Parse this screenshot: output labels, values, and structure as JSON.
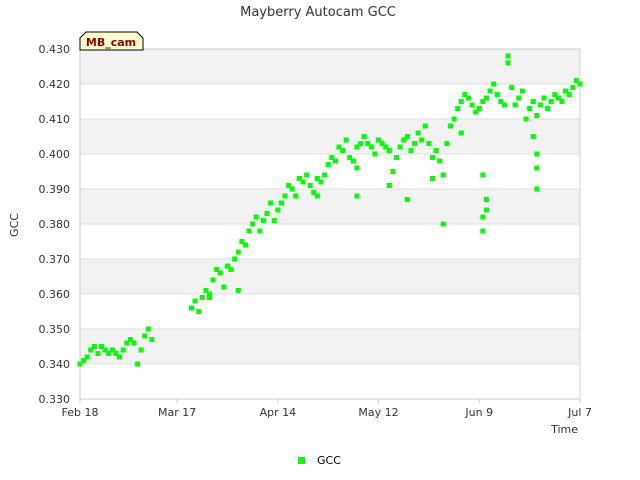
{
  "chart_data": {
    "type": "scatter",
    "title": "Mayberry Autocam GCC",
    "xlabel": "Time",
    "ylabel": "GCC",
    "badge": "MB_cam",
    "ylim": [
      0.33,
      0.43
    ],
    "yticks": [
      "0.330",
      "0.340",
      "0.350",
      "0.360",
      "0.370",
      "0.380",
      "0.390",
      "0.400",
      "0.410",
      "0.420",
      "0.430"
    ],
    "xlim": [
      "2014-02-18",
      "2014-07-07"
    ],
    "xticks": [
      {
        "date": "2014-02-18",
        "label": "Feb 18"
      },
      {
        "date": "2014-03-17",
        "label": "Mar 17"
      },
      {
        "date": "2014-04-14",
        "label": "Apr 14"
      },
      {
        "date": "2014-05-12",
        "label": "May 12"
      },
      {
        "date": "2014-06-09",
        "label": "Jun 9"
      },
      {
        "date": "2014-07-07",
        "label": "Jul 7"
      }
    ],
    "grid": true,
    "legend_position": "bottom-center",
    "series": [
      {
        "name": "GCC",
        "color": "#00ff00",
        "points": [
          [
            "2014-02-18",
            0.34
          ],
          [
            "2014-02-19",
            0.341
          ],
          [
            "2014-02-20",
            0.342
          ],
          [
            "2014-02-21",
            0.344
          ],
          [
            "2014-02-22",
            0.345
          ],
          [
            "2014-02-23",
            0.343
          ],
          [
            "2014-02-24",
            0.345
          ],
          [
            "2014-02-25",
            0.344
          ],
          [
            "2014-02-26",
            0.343
          ],
          [
            "2014-02-27",
            0.344
          ],
          [
            "2014-02-28",
            0.343
          ],
          [
            "2014-03-01",
            0.342
          ],
          [
            "2014-03-02",
            0.344
          ],
          [
            "2014-03-03",
            0.346
          ],
          [
            "2014-03-04",
            0.347
          ],
          [
            "2014-03-05",
            0.346
          ],
          [
            "2014-03-06",
            0.34
          ],
          [
            "2014-03-07",
            0.344
          ],
          [
            "2014-03-08",
            0.348
          ],
          [
            "2014-03-09",
            0.35
          ],
          [
            "2014-03-10",
            0.347
          ],
          [
            "2014-03-21",
            0.356
          ],
          [
            "2014-03-22",
            0.358
          ],
          [
            "2014-03-23",
            0.355
          ],
          [
            "2014-03-24",
            0.359
          ],
          [
            "2014-03-25",
            0.361
          ],
          [
            "2014-03-26",
            0.36
          ],
          [
            "2014-03-27",
            0.364
          ],
          [
            "2014-03-28",
            0.367
          ],
          [
            "2014-03-29",
            0.366
          ],
          [
            "2014-03-30",
            0.362
          ],
          [
            "2014-03-31",
            0.368
          ],
          [
            "2014-04-01",
            0.367
          ],
          [
            "2014-04-02",
            0.37
          ],
          [
            "2014-04-03",
            0.372
          ],
          [
            "2014-04-04",
            0.375
          ],
          [
            "2014-04-05",
            0.374
          ],
          [
            "2014-04-06",
            0.378
          ],
          [
            "2014-04-07",
            0.38
          ],
          [
            "2014-04-08",
            0.382
          ],
          [
            "2014-04-09",
            0.378
          ],
          [
            "2014-04-10",
            0.381
          ],
          [
            "2014-04-11",
            0.383
          ],
          [
            "2014-04-12",
            0.386
          ],
          [
            "2014-04-13",
            0.381
          ],
          [
            "2014-04-14",
            0.384
          ],
          [
            "2014-04-15",
            0.386
          ],
          [
            "2014-04-16",
            0.388
          ],
          [
            "2014-04-17",
            0.391
          ],
          [
            "2014-04-18",
            0.39
          ],
          [
            "2014-04-19",
            0.388
          ],
          [
            "2014-04-20",
            0.393
          ],
          [
            "2014-04-21",
            0.392
          ],
          [
            "2014-04-22",
            0.394
          ],
          [
            "2014-04-23",
            0.391
          ],
          [
            "2014-04-24",
            0.389
          ],
          [
            "2014-04-25",
            0.393
          ],
          [
            "2014-04-26",
            0.392
          ],
          [
            "2014-04-27",
            0.394
          ],
          [
            "2014-04-28",
            0.397
          ],
          [
            "2014-04-29",
            0.399
          ],
          [
            "2014-04-30",
            0.398
          ],
          [
            "2014-05-01",
            0.402
          ],
          [
            "2014-05-02",
            0.401
          ],
          [
            "2014-05-03",
            0.404
          ],
          [
            "2014-05-04",
            0.399
          ],
          [
            "2014-05-05",
            0.398
          ],
          [
            "2014-05-06",
            0.402
          ],
          [
            "2014-05-07",
            0.403
          ],
          [
            "2014-05-08",
            0.405
          ],
          [
            "2014-05-09",
            0.403
          ],
          [
            "2014-05-10",
            0.402
          ],
          [
            "2014-05-11",
            0.4
          ],
          [
            "2014-05-12",
            0.404
          ],
          [
            "2014-05-13",
            0.403
          ],
          [
            "2014-05-14",
            0.402
          ],
          [
            "2014-05-15",
            0.401
          ],
          [
            "2014-05-16",
            0.395
          ],
          [
            "2014-05-17",
            0.399
          ],
          [
            "2014-05-18",
            0.402
          ],
          [
            "2014-05-19",
            0.404
          ],
          [
            "2014-05-20",
            0.405
          ],
          [
            "2014-05-21",
            0.401
          ],
          [
            "2014-05-22",
            0.403
          ],
          [
            "2014-05-23",
            0.406
          ],
          [
            "2014-05-24",
            0.404
          ],
          [
            "2014-05-25",
            0.408
          ],
          [
            "2014-05-26",
            0.403
          ],
          [
            "2014-05-27",
            0.399
          ],
          [
            "2014-05-28",
            0.401
          ],
          [
            "2014-05-29",
            0.398
          ],
          [
            "2014-05-30",
            0.394
          ],
          [
            "2014-05-31",
            0.403
          ],
          [
            "2014-06-01",
            0.408
          ],
          [
            "2014-06-02",
            0.41
          ],
          [
            "2014-06-03",
            0.413
          ],
          [
            "2014-06-04",
            0.415
          ],
          [
            "2014-06-05",
            0.417
          ],
          [
            "2014-06-06",
            0.416
          ],
          [
            "2014-06-07",
            0.414
          ],
          [
            "2014-06-08",
            0.412
          ],
          [
            "2014-06-09",
            0.413
          ],
          [
            "2014-06-10",
            0.415
          ],
          [
            "2014-06-11",
            0.416
          ],
          [
            "2014-06-12",
            0.418
          ],
          [
            "2014-06-13",
            0.42
          ],
          [
            "2014-06-14",
            0.417
          ],
          [
            "2014-06-15",
            0.415
          ],
          [
            "2014-06-16",
            0.414
          ],
          [
            "2014-06-17",
            0.426
          ],
          [
            "2014-06-18",
            0.419
          ],
          [
            "2014-06-19",
            0.414
          ],
          [
            "2014-06-20",
            0.416
          ],
          [
            "2014-06-21",
            0.418
          ],
          [
            "2014-06-22",
            0.41
          ],
          [
            "2014-06-23",
            0.413
          ],
          [
            "2014-06-24",
            0.415
          ],
          [
            "2014-06-25",
            0.411
          ],
          [
            "2014-06-26",
            0.414
          ],
          [
            "2014-06-27",
            0.416
          ],
          [
            "2014-06-28",
            0.413
          ],
          [
            "2014-06-29",
            0.415
          ],
          [
            "2014-06-30",
            0.417
          ],
          [
            "2014-07-01",
            0.416
          ],
          [
            "2014-07-02",
            0.415
          ],
          [
            "2014-07-03",
            0.418
          ],
          [
            "2014-07-04",
            0.417
          ],
          [
            "2014-07-05",
            0.419
          ],
          [
            "2014-07-06",
            0.421
          ],
          [
            "2014-07-07",
            0.42
          ],
          [
            "2014-05-20",
            0.387
          ],
          [
            "2014-05-30",
            0.38
          ],
          [
            "2014-05-27",
            0.393
          ],
          [
            "2014-06-04",
            0.406
          ],
          [
            "2014-06-10",
            0.378
          ],
          [
            "2014-06-10",
            0.382
          ],
          [
            "2014-06-11",
            0.384
          ],
          [
            "2014-06-11",
            0.387
          ],
          [
            "2014-06-10",
            0.394
          ],
          [
            "2014-06-24",
            0.405
          ],
          [
            "2014-06-25",
            0.4
          ],
          [
            "2014-06-25",
            0.396
          ],
          [
            "2014-06-25",
            0.39
          ],
          [
            "2014-05-06",
            0.396
          ],
          [
            "2014-05-06",
            0.388
          ],
          [
            "2014-04-25",
            0.388
          ],
          [
            "2014-05-15",
            0.391
          ],
          [
            "2014-03-26",
            0.359
          ],
          [
            "2014-04-03",
            0.361
          ],
          [
            "2014-06-17",
            0.428
          ]
        ]
      }
    ]
  }
}
